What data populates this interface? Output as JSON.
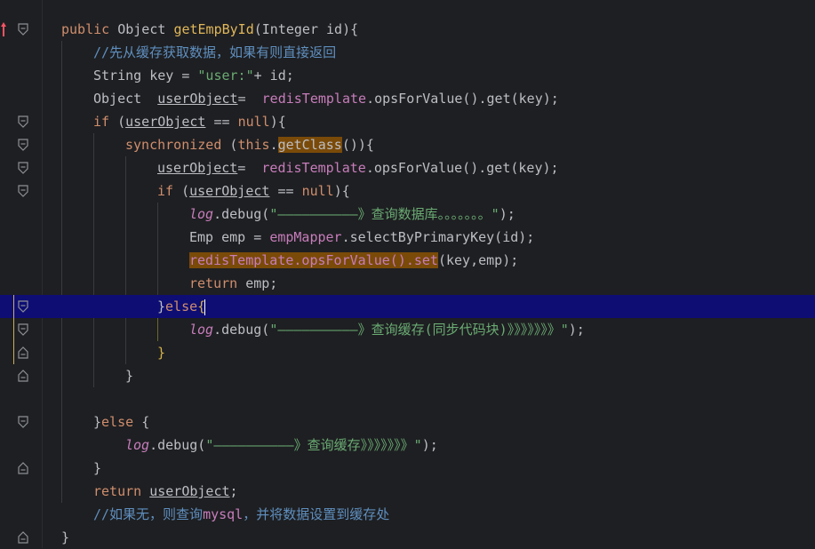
{
  "editor": {
    "language": "Java",
    "lines": [
      {
        "tokens": [
          {
            "t": "public ",
            "c": "kw"
          },
          {
            "t": "Object ",
            "c": "cls"
          },
          {
            "t": "getEmpById",
            "c": "fn-y"
          },
          {
            "t": "(Integer id){",
            "c": "cls"
          }
        ]
      },
      {
        "tokens": [
          {
            "t": "//先从缓存获取数据，如果有则直接返回",
            "c": "cmt-cn"
          }
        ]
      },
      {
        "tokens": [
          {
            "t": "String key = ",
            "c": "cls"
          },
          {
            "t": "\"user:\"",
            "c": "str"
          },
          {
            "t": "+ id;",
            "c": "cls"
          }
        ]
      },
      {
        "tokens": [
          {
            "t": "Object  ",
            "c": "cls"
          },
          {
            "t": "userObject",
            "c": "var-ul"
          },
          {
            "t": "=  ",
            "c": "cls"
          },
          {
            "t": "redisTemplate",
            "c": "field"
          },
          {
            "t": ".opsForValue().get(key);",
            "c": "cls"
          }
        ]
      },
      {
        "tokens": [
          {
            "t": "if ",
            "c": "kw"
          },
          {
            "t": "(",
            "c": "cls"
          },
          {
            "t": "userObject",
            "c": "var-ul"
          },
          {
            "t": " == ",
            "c": "cls"
          },
          {
            "t": "null",
            "c": "kw"
          },
          {
            "t": "){",
            "c": "cls"
          }
        ]
      },
      {
        "tokens": [
          {
            "t": "synchronized ",
            "c": "kw"
          },
          {
            "t": "(",
            "c": "cls"
          },
          {
            "t": "this",
            "c": "kw"
          },
          {
            "t": ".",
            "c": "cls"
          },
          {
            "t": "getClass",
            "c": "hl"
          },
          {
            "t": "()){",
            "c": "cls"
          }
        ]
      },
      {
        "tokens": [
          {
            "t": "userObject",
            "c": "var-ul"
          },
          {
            "t": "=  ",
            "c": "cls"
          },
          {
            "t": "redisTemplate",
            "c": "field"
          },
          {
            "t": ".opsForValue().get(key);",
            "c": "cls"
          }
        ]
      },
      {
        "tokens": [
          {
            "t": "if ",
            "c": "kw"
          },
          {
            "t": "(",
            "c": "cls"
          },
          {
            "t": "userObject",
            "c": "var-ul"
          },
          {
            "t": " == ",
            "c": "cls"
          },
          {
            "t": "null",
            "c": "kw"
          },
          {
            "t": "){",
            "c": "cls"
          }
        ]
      },
      {
        "tokens": [
          {
            "t": "log",
            "c": "ital"
          },
          {
            "t": ".debug(",
            "c": "cls"
          },
          {
            "t": "\"——————————》查询数据库。。。。。。。\"",
            "c": "str"
          },
          {
            "t": ");",
            "c": "cls"
          }
        ]
      },
      {
        "tokens": [
          {
            "t": "Emp emp = ",
            "c": "cls"
          },
          {
            "t": "empMapper",
            "c": "field"
          },
          {
            "t": ".selectByPrimaryKey(id);",
            "c": "cls"
          }
        ]
      },
      {
        "tokens": [
          {
            "t": "redisTemplate.opsForValue().set",
            "c": "hl-field"
          },
          {
            "t": "(key,emp);",
            "c": "cls"
          }
        ]
      },
      {
        "tokens": [
          {
            "t": "return ",
            "c": "kw"
          },
          {
            "t": "emp;",
            "c": "cls"
          }
        ]
      },
      {
        "tokens": [
          {
            "t": "}",
            "c": "cls"
          },
          {
            "t": "else",
            "c": "kw"
          },
          {
            "t": "{",
            "c": "brace-y"
          }
        ]
      },
      {
        "tokens": [
          {
            "t": "log",
            "c": "ital"
          },
          {
            "t": ".debug(",
            "c": "cls"
          },
          {
            "t": "\"——————————》查询缓存(同步代码块)》》》》》》》\"",
            "c": "str"
          },
          {
            "t": ");",
            "c": "cls"
          }
        ]
      },
      {
        "tokens": [
          {
            "t": "}",
            "c": "brace-y"
          }
        ]
      },
      {
        "tokens": [
          {
            "t": "}",
            "c": "cls"
          }
        ]
      },
      {
        "tokens": []
      },
      {
        "tokens": [
          {
            "t": "}",
            "c": "cls"
          },
          {
            "t": "else ",
            "c": "kw"
          },
          {
            "t": "{",
            "c": "cls"
          }
        ]
      },
      {
        "tokens": [
          {
            "t": "log",
            "c": "ital"
          },
          {
            "t": ".debug(",
            "c": "cls"
          },
          {
            "t": "\"——————————》查询缓存》》》》》》》\"",
            "c": "str"
          },
          {
            "t": ");",
            "c": "cls"
          }
        ]
      },
      {
        "tokens": [
          {
            "t": "}",
            "c": "cls"
          }
        ]
      },
      {
        "tokens": [
          {
            "t": "return ",
            "c": "kw"
          },
          {
            "t": "userObject",
            "c": "var-ul"
          },
          {
            "t": ";",
            "c": "cls"
          }
        ]
      },
      {
        "tokens": [
          {
            "t": "//如果无，则查询",
            "c": "cmt-cn"
          },
          {
            "t": "mysql",
            "c": "field"
          },
          {
            "t": "，并将数据设置到缓存处",
            "c": "cmt-cn"
          }
        ]
      },
      {
        "tokens": [
          {
            "t": "}",
            "c": "cls"
          }
        ]
      }
    ],
    "current_line": 12
  },
  "colors": {
    "background": "#1e1f22",
    "current_line": "#0d0d74",
    "keyword": "#cf8e6d",
    "string": "#6aab73",
    "field": "#c77dbb",
    "highlight": "#7a4a08",
    "override_marker": "#f75464"
  },
  "icons": {
    "override_marker": "override-up-arrow-icon",
    "fold": "fold-toggle-icon"
  }
}
